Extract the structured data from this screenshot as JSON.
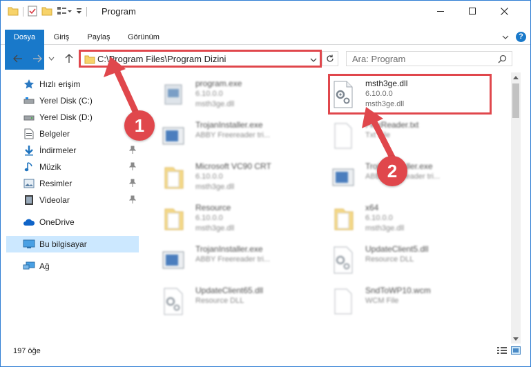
{
  "window": {
    "title": "Program"
  },
  "ribbon": {
    "tabs": [
      "Dosya",
      "Giriş",
      "Paylaş",
      "Görünüm"
    ]
  },
  "nav": {
    "address_path": "C:\\Program Files\\Program Dizini",
    "search_placeholder": "Ara: Program"
  },
  "sidebar": {
    "items": [
      {
        "label": "Hızlı erişim",
        "icon": "star-icon"
      },
      {
        "label": "Yerel Disk (C:)",
        "icon": "drive-icon"
      },
      {
        "label": "Yerel Disk (D:)",
        "icon": "drive-icon"
      },
      {
        "label": "Belgeler",
        "icon": "documents-icon"
      },
      {
        "label": "İndirmeler",
        "icon": "download-icon"
      },
      {
        "label": "Müzik",
        "icon": "music-icon"
      },
      {
        "label": "Resimler",
        "icon": "pictures-icon"
      },
      {
        "label": "Videolar",
        "icon": "video-icon"
      },
      {
        "label": "OneDrive",
        "icon": "cloud-icon"
      },
      {
        "label": "Bu bilgisayar",
        "icon": "computer-icon"
      },
      {
        "label": "Ağ",
        "icon": "network-icon"
      }
    ]
  },
  "files": [
    {
      "name": "program.exe",
      "line1": "6.10.0.0",
      "line2": "msth3ge.dll",
      "icon": "exe-icon"
    },
    {
      "name": "msth3ge.dll",
      "line1": "6.10.0.0",
      "line2": "msth3ge.dll",
      "icon": "dll-gear-icon"
    },
    {
      "name": "TrojanInstaller.exe",
      "line1": "ABBY Freereader tri...",
      "line2": "",
      "icon": "installer-icon"
    },
    {
      "name": "FlexReader.txt",
      "line1": "Txt File",
      "line2": "",
      "icon": "text-file-icon"
    },
    {
      "name": "Microsoft VC90 CRT",
      "line1": "6.10.0.0",
      "line2": "msth3ge.dll",
      "icon": "folder-icon"
    },
    {
      "name": "TrojanInstaller.exe",
      "line1": "ABBY Freereader tri...",
      "line2": "",
      "icon": "installer-icon"
    },
    {
      "name": "Resource",
      "line1": "6.10.0.0",
      "line2": "msth3ge.dll",
      "icon": "folder-icon"
    },
    {
      "name": "x64",
      "line1": "6.10.0.0",
      "line2": "msth3ge.dll",
      "icon": "folder-icon"
    },
    {
      "name": "TrojanInstaller.exe",
      "line1": "ABBY Freereader tri...",
      "line2": "",
      "icon": "installer-icon"
    },
    {
      "name": "UpdateClient5.dll",
      "line1": "Resource DLL",
      "line2": "",
      "icon": "dll-gear-icon"
    },
    {
      "name": "UpdateClient65.dll",
      "line1": "Resource DLL",
      "line2": "",
      "icon": "dll-gear-icon"
    },
    {
      "name": "SndToWP10.wcm",
      "line1": "WCM File",
      "line2": "",
      "icon": "blank-file-icon"
    }
  ],
  "status": {
    "item_count": "197 öğe"
  },
  "callouts": [
    "1",
    "2"
  ],
  "colors": {
    "accent": "#1979ca",
    "highlight": "#e0474c",
    "selected": "#cce8ff"
  }
}
